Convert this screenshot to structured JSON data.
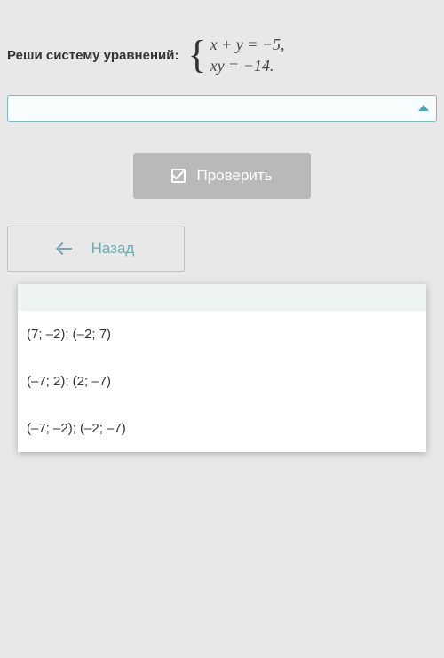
{
  "prompt": {
    "label": "Реши систему уравнений:",
    "equation1": "x + y = −5,",
    "equation2": "xy = −14."
  },
  "dropdown": {
    "value": ""
  },
  "buttons": {
    "check": "Проверить",
    "back": "Назад"
  },
  "options": [
    "(7; –2); (–2; 7)",
    "(–7; 2); (2; –7)",
    "(–7; –2); (–2; –7)"
  ]
}
